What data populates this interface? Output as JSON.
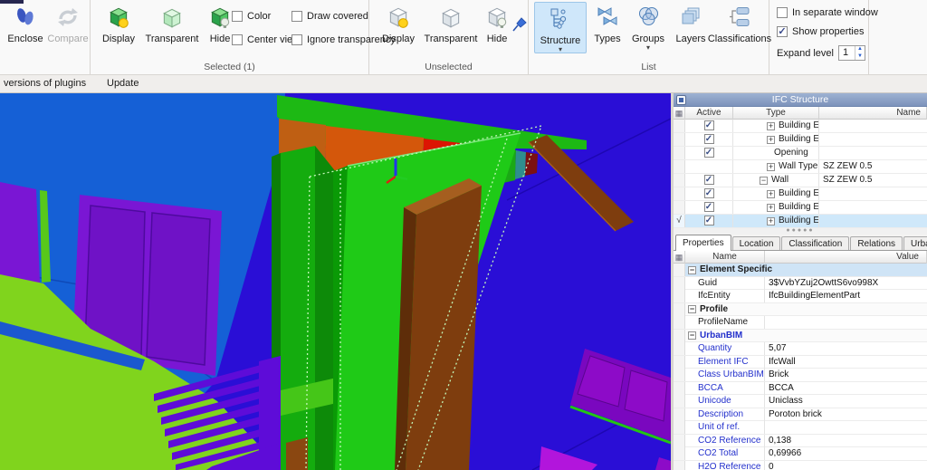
{
  "ribbon": {
    "groups": [
      {
        "label": "",
        "buttons": [
          {
            "label": "Enclose",
            "disabled": false
          },
          {
            "label": "Compare",
            "disabled": true
          }
        ]
      },
      {
        "label": "Selected (1)",
        "buttons": [
          {
            "label": "Display"
          },
          {
            "label": "Transparent"
          },
          {
            "label": "Hide"
          }
        ],
        "checkboxes": [
          {
            "label": "Color",
            "checked": false
          },
          {
            "label": "Center view",
            "checked": false
          },
          {
            "label": "Draw covered",
            "checked": false
          },
          {
            "label": "Ignore transparency",
            "checked": false
          }
        ]
      },
      {
        "label": "Unselected",
        "buttons": [
          {
            "label": "Display"
          },
          {
            "label": "Transparent"
          },
          {
            "label": "Hide"
          }
        ]
      },
      {
        "label": "List",
        "buttons": [
          {
            "label": "Structure",
            "active": true,
            "dropdown": true
          },
          {
            "label": "Types",
            "active": false,
            "dropdown": false
          },
          {
            "label": "Groups",
            "active": false,
            "dropdown": true
          },
          {
            "label": "Layers",
            "active": false,
            "dropdown": false
          },
          {
            "label": "Classifications",
            "active": false,
            "dropdown": false
          }
        ]
      },
      {
        "label": "",
        "checkboxes": [
          {
            "label": "In separate window",
            "checked": false
          },
          {
            "label": "Show properties",
            "checked": true
          }
        ],
        "spinner": {
          "label": "Expand level",
          "value": "1"
        }
      }
    ]
  },
  "menubar": {
    "items": [
      {
        "label": "versions of plugins"
      },
      {
        "label": "Update"
      }
    ]
  },
  "structure_panel": {
    "title": "IFC Structure",
    "columns": {
      "active": "Active",
      "type": "Type",
      "name": "Name"
    },
    "rows": [
      {
        "checked": true,
        "expander": "plus",
        "indent": 2,
        "type": "Building Ele...",
        "name": "",
        "selected": false
      },
      {
        "checked": true,
        "expander": "plus",
        "indent": 2,
        "type": "Building Ele...",
        "name": "",
        "selected": false
      },
      {
        "checked": true,
        "expander": "none",
        "indent": 3,
        "type": "Opening",
        "name": "",
        "selected": false
      },
      {
        "checked": null,
        "expander": "plus",
        "indent": 2,
        "type": "Wall Type",
        "name": "SZ ZEW 0.5",
        "selected": false
      },
      {
        "checked": true,
        "expander": "minus",
        "indent": 1,
        "type": "Wall",
        "name": "SZ ZEW 0.5",
        "selected": false
      },
      {
        "checked": true,
        "expander": "plus",
        "indent": 2,
        "type": "Building Ele...",
        "name": "",
        "selected": false
      },
      {
        "checked": true,
        "expander": "plus",
        "indent": 2,
        "type": "Building Ele...",
        "name": "",
        "selected": false
      },
      {
        "checked": true,
        "expander": "plus",
        "indent": 2,
        "type": "Building Ele...",
        "name": "",
        "selected": true
      }
    ]
  },
  "properties_panel": {
    "tabs": [
      {
        "label": "Properties",
        "active": true
      },
      {
        "label": "Location",
        "active": false
      },
      {
        "label": "Classification",
        "active": false
      },
      {
        "label": "Relations",
        "active": false
      },
      {
        "label": "Urban BIM",
        "active": false
      }
    ],
    "columns": {
      "name": "Name",
      "value": "Value"
    },
    "rows": [
      {
        "kind": "group",
        "name": "Element Specific",
        "highlight": true,
        "blue": false
      },
      {
        "kind": "prop",
        "name": "Guid",
        "value": "3$VvbYZuj2OwttS6vo998X",
        "blue": false
      },
      {
        "kind": "prop",
        "name": "IfcEntity",
        "value": "IfcBuildingElementPart",
        "blue": false
      },
      {
        "kind": "group",
        "name": "Profile",
        "highlight": false,
        "blue": false
      },
      {
        "kind": "prop",
        "name": "ProfileName",
        "value": "",
        "blue": false
      },
      {
        "kind": "group",
        "name": "UrbanBIM",
        "highlight": false,
        "blue": true
      },
      {
        "kind": "prop",
        "name": "Quantity",
        "value": "5,07",
        "blue": true
      },
      {
        "kind": "prop",
        "name": "Element IFC",
        "value": "IfcWall",
        "blue": true
      },
      {
        "kind": "prop",
        "name": "Class UrbanBIM",
        "value": "Brick",
        "blue": true
      },
      {
        "kind": "prop",
        "name": "BCCA",
        "value": "BCCA",
        "blue": true
      },
      {
        "kind": "prop",
        "name": "Unicode",
        "value": "Uniclass",
        "blue": true
      },
      {
        "kind": "prop",
        "name": "Description",
        "value": "Poroton brick",
        "blue": true
      },
      {
        "kind": "prop",
        "name": "Unit of ref.",
        "value": "",
        "blue": true
      },
      {
        "kind": "prop",
        "name": "CO2 Reference",
        "value": "0,138",
        "blue": true
      },
      {
        "kind": "prop",
        "name": "CO2 Total",
        "value": "0,69966",
        "blue": true
      },
      {
        "kind": "prop",
        "name": "H2O Reference",
        "value": "0",
        "blue": true
      }
    ]
  },
  "viewport": {
    "colors": {
      "wall_blue": "#1560d6",
      "wall_indigo": "#2a0ed6",
      "grass_green": "#80d41d",
      "element_green": "#1fca17",
      "slab_green": "#14ac0e",
      "dark_green": "#0d8a09",
      "orange_dark": "#bf5f13",
      "orange": "#d4570b",
      "red": "#dc1503",
      "teal": "#2e8e8e",
      "dark_red": "#7c1111",
      "brown": "#7e3d0e",
      "violet": "#5e0cd8",
      "purple_panel": "#7a16d4",
      "window_purple": "#7a07bf",
      "magenta": "#b215dc",
      "selection_dash": "#c2f7b8"
    }
  }
}
